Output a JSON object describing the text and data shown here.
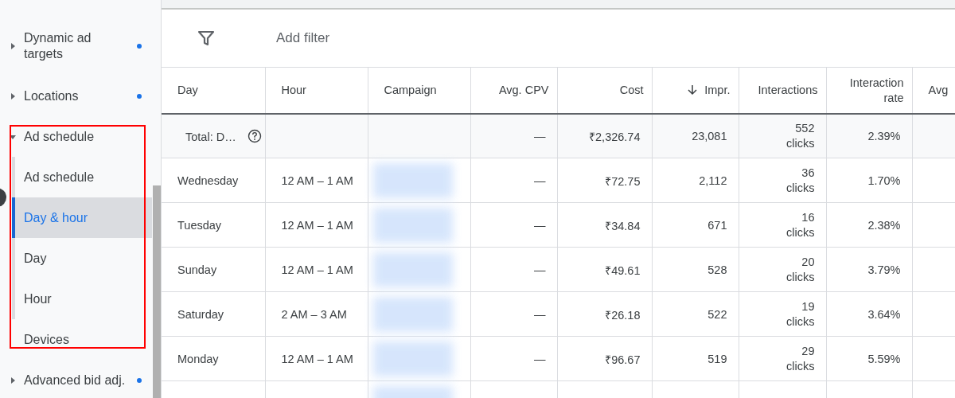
{
  "sidebar": {
    "items": [
      {
        "kind": "group",
        "label": "Dynamic ad targets",
        "expanded": false,
        "dot": true
      },
      {
        "kind": "group",
        "label": "Locations",
        "expanded": false,
        "dot": true
      },
      {
        "kind": "group",
        "label": "Ad schedule",
        "expanded": true,
        "dot": false,
        "children": [
          {
            "label": "Ad schedule",
            "selected": false
          },
          {
            "label": "Day & hour",
            "selected": true
          },
          {
            "label": "Day",
            "selected": false
          },
          {
            "label": "Hour",
            "selected": false
          }
        ]
      },
      {
        "kind": "link",
        "label": "Devices",
        "dot": false
      },
      {
        "kind": "group",
        "label": "Advanced bid adj.",
        "expanded": false,
        "dot": true
      }
    ]
  },
  "filter_bar": {
    "placeholder": "Add filter"
  },
  "table": {
    "columns": [
      {
        "label": "Day",
        "sorted": false
      },
      {
        "label": "Hour",
        "sorted": false
      },
      {
        "label": "Campaign",
        "sorted": false
      },
      {
        "label": "Avg. CPV",
        "sorted": false
      },
      {
        "label": "Cost",
        "sorted": false
      },
      {
        "label": "Impr.",
        "sorted": true
      },
      {
        "label": "Interactions",
        "sorted": false
      },
      {
        "label": "Interaction rate",
        "sorted": false
      },
      {
        "label": "Avg",
        "sorted": false
      }
    ],
    "total": {
      "label": "Total: D…",
      "avg_cpv": "—",
      "cost": "₹2,326.74",
      "impr": "23,081",
      "interactions": "552 clicks",
      "rate": "2.39%"
    },
    "rows": [
      {
        "day": "Wednesday",
        "hour": "12 AM – 1 AM",
        "avg_cpv": "—",
        "cost": "₹72.75",
        "impr": "2,112",
        "interactions": "36 clicks",
        "rate": "1.70%"
      },
      {
        "day": "Tuesday",
        "hour": "12 AM – 1 AM",
        "avg_cpv": "—",
        "cost": "₹34.84",
        "impr": "671",
        "interactions": "16 clicks",
        "rate": "2.38%"
      },
      {
        "day": "Sunday",
        "hour": "12 AM – 1 AM",
        "avg_cpv": "—",
        "cost": "₹49.61",
        "impr": "528",
        "interactions": "20 clicks",
        "rate": "3.79%"
      },
      {
        "day": "Saturday",
        "hour": "2 AM – 3 AM",
        "avg_cpv": "—",
        "cost": "₹26.18",
        "impr": "522",
        "interactions": "19 clicks",
        "rate": "3.64%"
      },
      {
        "day": "Monday",
        "hour": "12 AM – 1 AM",
        "avg_cpv": "—",
        "cost": "₹96.67",
        "impr": "519",
        "interactions": "29 clicks",
        "rate": "5.59%"
      }
    ]
  }
}
